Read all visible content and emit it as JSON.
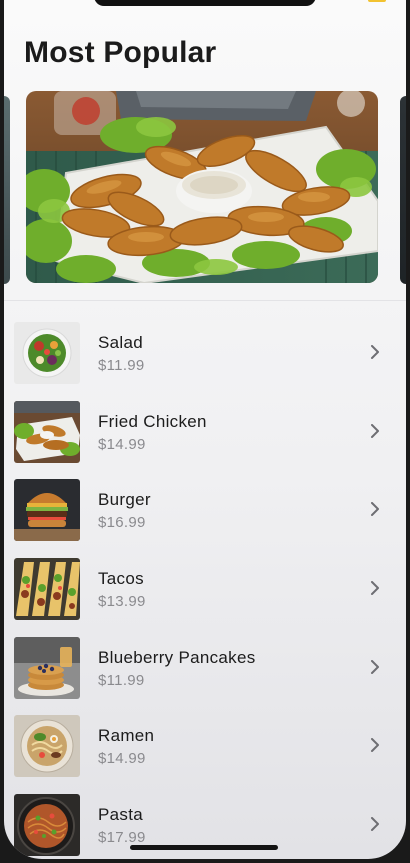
{
  "screen": {
    "title": "Most Popular"
  },
  "hero": {
    "icon": "fried-chicken-platter-image"
  },
  "menu": {
    "items": [
      {
        "name": "Salad",
        "price": "$11.99",
        "icon": "salad-image"
      },
      {
        "name": "Fried Chicken",
        "price": "$14.99",
        "icon": "fried-chicken-image"
      },
      {
        "name": "Burger",
        "price": "$16.99",
        "icon": "burger-image"
      },
      {
        "name": "Tacos",
        "price": "$13.99",
        "icon": "tacos-image"
      },
      {
        "name": "Blueberry Pancakes",
        "price": "$11.99",
        "icon": "pancakes-image"
      },
      {
        "name": "Ramen",
        "price": "$14.99",
        "icon": "ramen-image"
      },
      {
        "name": "Pasta",
        "price": "$17.99",
        "icon": "pasta-image"
      }
    ]
  },
  "colors": {
    "background": "#fafafa",
    "title": "#1b1b1b",
    "price": "#8a8a8e",
    "chevron": "#6e6e73"
  }
}
